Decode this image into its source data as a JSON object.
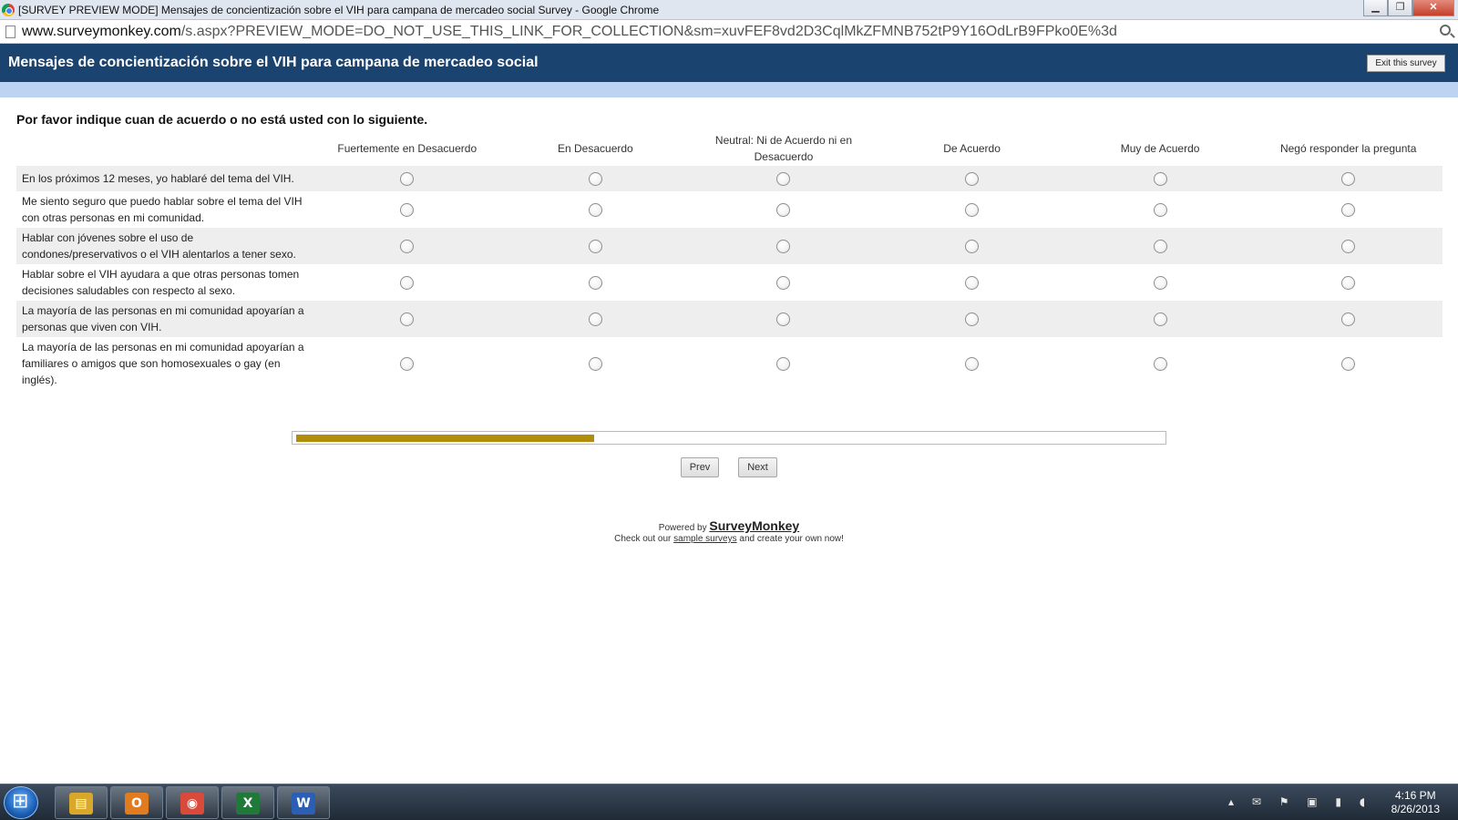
{
  "window": {
    "title": "[SURVEY PREVIEW MODE] Mensajes de concientización sobre el VIH para campana de mercadeo social Survey - Google Chrome",
    "min": "▁",
    "max": "❐",
    "close": "✕"
  },
  "browser": {
    "url_host": "www.surveymonkey.com",
    "url_path": "/s.aspx?PREVIEW_MODE=DO_NOT_USE_THIS_LINK_FOR_COLLECTION&sm=xuvFEF8vd2D3CqlMkZFMNB752tP9Y16OdLrB9FPko0E%3d"
  },
  "survey": {
    "title": "Mensajes de concientización sobre el VIH para campana de mercadeo social",
    "exit_label": "Exit this survey"
  },
  "question": {
    "text": "Por favor indique cuan de acuerdo o no está usted con lo siguiente.",
    "columns": [
      "Fuertemente en Desacuerdo",
      "En Desacuerdo",
      "Neutral: Ni de Acuerdo ni en Desacuerdo",
      "De Acuerdo",
      "Muy de Acuerdo",
      "Negó responder la pregunta"
    ],
    "rows": [
      "En los próximos 12 meses, yo hablaré del tema del VIH.",
      "Me siento seguro que puedo hablar sobre el tema del VIH con otras personas en mi comunidad.",
      "Hablar con jóvenes sobre el uso de condones/preservativos o el VIH alentarlos a tener sexo.",
      "Hablar sobre el VIH ayudara a que otras personas tomen decisiones saludables con respecto al sexo.",
      "La mayoría de las personas en mi comunidad apoyarían a personas que viven con VIH.",
      "La mayoría de las personas en mi comunidad apoyarían a familiares o amigos que son homosexuales o gay (en inglés)."
    ]
  },
  "progress": {
    "fraction": 0.35,
    "color": "#b08d0b"
  },
  "nav": {
    "prev": "Prev",
    "next": "Next"
  },
  "footer": {
    "powered_by": "Powered by",
    "brand": "SurveyMonkey",
    "checkout_pre": "Check out our",
    "checkout_link": "sample surveys",
    "checkout_post": "and create your own now!"
  },
  "taskbar": {
    "apps": [
      {
        "icon": "file-explorer-icon",
        "glyph": "▤",
        "color": "#d9a72a"
      },
      {
        "icon": "outlook-icon",
        "glyph": "O",
        "color": "#e07b1f"
      },
      {
        "icon": "chrome-icon",
        "glyph": "◉",
        "color": "#d84b3a"
      },
      {
        "icon": "excel-icon",
        "glyph": "X",
        "color": "#1f7a3a"
      },
      {
        "icon": "word-icon",
        "glyph": "W",
        "color": "#2b5fb4"
      }
    ],
    "tray_icons": "▴ ✉ ⚑ ▣ ▮ ◖",
    "time": "4:16 PM",
    "date": "8/26/2013"
  }
}
